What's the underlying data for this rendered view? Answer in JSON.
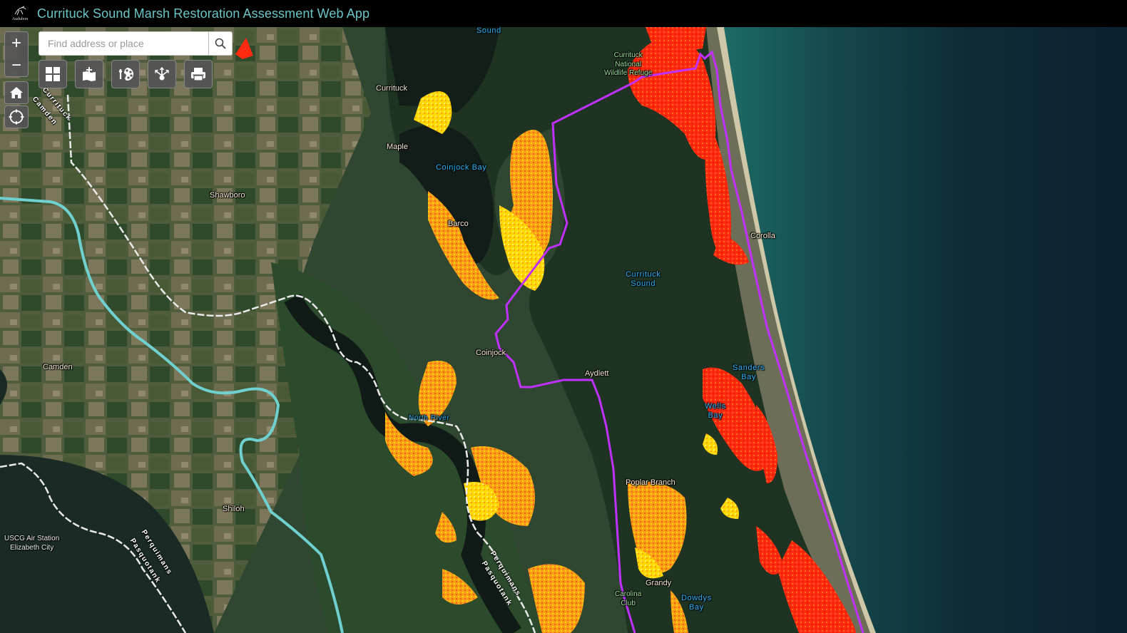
{
  "header": {
    "logo_text": "Audubon",
    "title": "Currituck Sound Marsh Restoration Assessment Web App",
    "title_color": "#6cc5c5"
  },
  "search": {
    "placeholder": "Find address or place",
    "value": ""
  },
  "map_controls": {
    "zoom_in_label": "+",
    "zoom_out_label": "−",
    "buttons": [
      {
        "name": "home",
        "icon": "home-icon"
      },
      {
        "name": "locate",
        "icon": "locate-crosshair-icon"
      }
    ]
  },
  "toolbar": {
    "tools": [
      {
        "name": "basemap-gallery",
        "icon": "grid-icon"
      },
      {
        "name": "add-data",
        "icon": "add-data-icon"
      },
      {
        "name": "legend-style",
        "icon": "palette-icon"
      },
      {
        "name": "share",
        "icon": "share-icon"
      },
      {
        "name": "print",
        "icon": "printer-icon"
      }
    ]
  },
  "map": {
    "layer_colors": {
      "marsh_high": "#ff2a10",
      "marsh_mid": "#ff8c10",
      "marsh_low": "#ffd800",
      "boundary": "#c030ff",
      "county_line": "#6fd0d0"
    },
    "labels": {
      "towns": [
        {
          "text": "Currituck"
        },
        {
          "text": "Maple"
        },
        {
          "text": "Shawboro"
        },
        {
          "text": "Barco"
        },
        {
          "text": "Corolla"
        },
        {
          "text": "Coinjock"
        },
        {
          "text": "Aydlett"
        },
        {
          "text": "Camden"
        },
        {
          "text": "Shiloh"
        },
        {
          "text": "Poplar Branch"
        },
        {
          "text": "Grandy"
        }
      ],
      "water": [
        {
          "text": "Sound"
        },
        {
          "text": "Coinjock Bay"
        },
        {
          "text": "Currituck\nSound"
        },
        {
          "text": "North River"
        },
        {
          "text": "Sanders\nBay"
        },
        {
          "text": "Wells\nBay"
        },
        {
          "text": "Dowdys\nBay"
        }
      ],
      "parks": [
        {
          "text": "Currituck\nNational\nWildlife Refuge"
        },
        {
          "text": "Carolina\nClub"
        }
      ],
      "stations": [
        {
          "text": "USCG Air Station\nElizabeth City"
        }
      ],
      "boundaries": [
        {
          "text": "Currituck"
        },
        {
          "text": "Camden"
        },
        {
          "text": "Perquimans"
        },
        {
          "text": "Pasquotank"
        },
        {
          "text": "Perquimans"
        },
        {
          "text": "Pasquotank"
        }
      ]
    }
  }
}
